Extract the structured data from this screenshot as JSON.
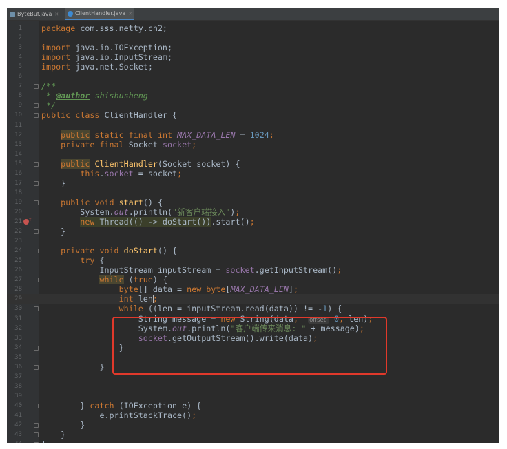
{
  "tabs": [
    {
      "label": "ByteBuf.java",
      "active": false,
      "icon": "java-interface-file-icon"
    },
    {
      "label": "ClientHandler.java",
      "active": true,
      "icon": "java-class-file-icon"
    }
  ],
  "editor": {
    "language": "Java",
    "theme": "Darcula",
    "current_line": 29,
    "breakpoint_line": 21,
    "highlight_box_lines": [
      30,
      34
    ],
    "param_hint": "offset:",
    "lines": [
      {
        "n": "1",
        "tokens": [
          {
            "t": "package",
            "c": "kw"
          },
          {
            "t": " com.sss.netty.ch2;"
          }
        ]
      },
      {
        "n": "2",
        "tokens": []
      },
      {
        "n": "3",
        "tokens": [
          {
            "t": "import",
            "c": "kw"
          },
          {
            "t": " java.io.IOException;"
          }
        ]
      },
      {
        "n": "4",
        "tokens": [
          {
            "t": "import",
            "c": "kw"
          },
          {
            "t": " java.io.InputStream;"
          }
        ]
      },
      {
        "n": "5",
        "tokens": [
          {
            "t": "import",
            "c": "kw"
          },
          {
            "t": " java.net.Socket;"
          }
        ]
      },
      {
        "n": "6",
        "tokens": []
      },
      {
        "n": "7",
        "tokens": [
          {
            "t": "/**",
            "c": "cmt"
          }
        ]
      },
      {
        "n": "8",
        "tokens": [
          {
            "t": " * ",
            "c": "cmt"
          },
          {
            "t": "@author",
            "c": "tag"
          },
          {
            "t": " shishusheng",
            "c": "cmt"
          }
        ]
      },
      {
        "n": "9",
        "tokens": [
          {
            "t": " */",
            "c": "cmt"
          }
        ]
      },
      {
        "n": "10",
        "tokens": [
          {
            "t": "public class",
            "c": "kw"
          },
          {
            "t": " ClientHandler {"
          }
        ]
      },
      {
        "n": "11",
        "tokens": []
      },
      {
        "n": "12",
        "tokens": [
          {
            "t": "    "
          },
          {
            "t": "public",
            "c": "kw hl"
          },
          {
            "t": " static final int",
            "c": "kw"
          },
          {
            "t": " "
          },
          {
            "t": "MAX_DATA_LEN",
            "c": "cst"
          },
          {
            "t": " = "
          },
          {
            "t": "1024",
            "c": "num"
          },
          {
            "t": ";",
            "c": "kw"
          }
        ]
      },
      {
        "n": "13",
        "tokens": [
          {
            "t": "    "
          },
          {
            "t": "private final",
            "c": "kw"
          },
          {
            "t": " Socket "
          },
          {
            "t": "socket",
            "c": "fld"
          },
          {
            "t": ";",
            "c": "kw"
          }
        ]
      },
      {
        "n": "14",
        "tokens": []
      },
      {
        "n": "15",
        "tokens": [
          {
            "t": "    "
          },
          {
            "t": "public",
            "c": "kw hl"
          },
          {
            "t": " "
          },
          {
            "t": "ClientHandler",
            "c": "mth"
          },
          {
            "t": "(Socket socket) {"
          }
        ]
      },
      {
        "n": "16",
        "tokens": [
          {
            "t": "        "
          },
          {
            "t": "this",
            "c": "kw"
          },
          {
            "t": "."
          },
          {
            "t": "socket",
            "c": "fld"
          },
          {
            "t": " = socket"
          },
          {
            "t": ";",
            "c": "kw"
          }
        ]
      },
      {
        "n": "17",
        "tokens": [
          {
            "t": "    }"
          }
        ]
      },
      {
        "n": "18",
        "tokens": []
      },
      {
        "n": "19",
        "tokens": [
          {
            "t": "    "
          },
          {
            "t": "public void",
            "c": "kw"
          },
          {
            "t": " "
          },
          {
            "t": "start",
            "c": "mth"
          },
          {
            "t": "() {"
          }
        ]
      },
      {
        "n": "20",
        "tokens": [
          {
            "t": "        System."
          },
          {
            "t": "out",
            "c": "cst"
          },
          {
            "t": ".println("
          },
          {
            "t": "\"新客户端接入\"",
            "c": "str"
          },
          {
            "t": ")"
          },
          {
            "t": ";",
            "c": "kw"
          }
        ]
      },
      {
        "n": "21",
        "tokens": [
          {
            "t": "        "
          },
          {
            "t": "new",
            "c": "kw hlbox"
          },
          {
            "t": " Thread(() -> doStart())",
            "c": "hlbox"
          },
          {
            "t": ".start()"
          },
          {
            "t": ";",
            "c": "kw"
          }
        ]
      },
      {
        "n": "22",
        "tokens": [
          {
            "t": "    }"
          }
        ]
      },
      {
        "n": "23",
        "tokens": []
      },
      {
        "n": "24",
        "tokens": [
          {
            "t": "    "
          },
          {
            "t": "private void",
            "c": "kw"
          },
          {
            "t": " "
          },
          {
            "t": "doStart",
            "c": "mth"
          },
          {
            "t": "() {"
          }
        ]
      },
      {
        "n": "25",
        "tokens": [
          {
            "t": "        "
          },
          {
            "t": "try",
            "c": "kw"
          },
          {
            "t": " {"
          }
        ]
      },
      {
        "n": "26",
        "tokens": [
          {
            "t": "            InputStream inputStream = "
          },
          {
            "t": "socket",
            "c": "fld"
          },
          {
            "t": ".getInputStream()"
          },
          {
            "t": ";",
            "c": "kw"
          }
        ]
      },
      {
        "n": "27",
        "tokens": [
          {
            "t": "            "
          },
          {
            "t": "while",
            "c": "kw hl"
          },
          {
            "t": " ("
          },
          {
            "t": "true",
            "c": "kw"
          },
          {
            "t": ") {"
          }
        ]
      },
      {
        "n": "28",
        "tokens": [
          {
            "t": "                "
          },
          {
            "t": "byte",
            "c": "kw"
          },
          {
            "t": "[] data = "
          },
          {
            "t": "new byte",
            "c": "kw"
          },
          {
            "t": "["
          },
          {
            "t": "MAX_DATA_LEN",
            "c": "cst"
          },
          {
            "t": "]"
          },
          {
            "t": ";",
            "c": "kw"
          }
        ]
      },
      {
        "n": "29",
        "tokens": [
          {
            "t": "                "
          },
          {
            "t": "int",
            "c": "kw"
          },
          {
            "t": " len"
          },
          {
            "t": ";",
            "c": "kw"
          }
        ]
      },
      {
        "n": "30",
        "tokens": [
          {
            "t": "                "
          },
          {
            "t": "while",
            "c": "kw"
          },
          {
            "t": " ((len = inputStream.read(data)) != -"
          },
          {
            "t": "1",
            "c": "num"
          },
          {
            "t": ") {"
          }
        ]
      },
      {
        "n": "31",
        "tokens": [
          {
            "t": "                    String message = "
          },
          {
            "t": "new",
            "c": "kw"
          },
          {
            "t": " String(data"
          },
          {
            "t": ",",
            "c": "kw"
          },
          {
            "t": "  "
          },
          {
            "t": "offset:",
            "c": "hint",
            "bind": "editor.param_hint"
          },
          {
            "t": " "
          },
          {
            "t": "0",
            "c": "num"
          },
          {
            "t": ",",
            "c": "kw"
          },
          {
            "t": " len)"
          },
          {
            "t": ";",
            "c": "kw"
          }
        ]
      },
      {
        "n": "32",
        "tokens": [
          {
            "t": "                    System."
          },
          {
            "t": "out",
            "c": "cst"
          },
          {
            "t": ".println("
          },
          {
            "t": "\"客户端传来消息: \"",
            "c": "str"
          },
          {
            "t": " + message)"
          },
          {
            "t": ";",
            "c": "kw"
          }
        ]
      },
      {
        "n": "33",
        "tokens": [
          {
            "t": "                    "
          },
          {
            "t": "socket",
            "c": "fld"
          },
          {
            "t": ".getOutputStream().write(data)"
          },
          {
            "t": ";",
            "c": "kw"
          }
        ]
      },
      {
        "n": "34",
        "tokens": [
          {
            "t": "                }"
          }
        ]
      },
      {
        "n": "35",
        "tokens": []
      },
      {
        "n": "36",
        "tokens": [
          {
            "t": "            }"
          }
        ]
      },
      {
        "n": "37",
        "tokens": []
      },
      {
        "n": "38",
        "tokens": []
      },
      {
        "n": "39",
        "tokens": []
      },
      {
        "n": "40",
        "tokens": [
          {
            "t": "        } "
          },
          {
            "t": "catch",
            "c": "kw"
          },
          {
            "t": " (IOException e) {"
          }
        ]
      },
      {
        "n": "41",
        "tokens": [
          {
            "t": "            e.printStackTrace()"
          },
          {
            "t": ";",
            "c": "kw"
          }
        ]
      },
      {
        "n": "42",
        "tokens": [
          {
            "t": "        }"
          }
        ]
      },
      {
        "n": "43",
        "tokens": [
          {
            "t": "    }"
          }
        ]
      },
      {
        "n": "44",
        "tokens": [
          {
            "t": "}"
          }
        ]
      }
    ]
  },
  "colors": {
    "background": "#2b2b2b",
    "gutter": "#313335",
    "keyword": "#cc7832",
    "string": "#6a8759",
    "method": "#ffc66d",
    "field": "#9876aa",
    "number": "#6897bb",
    "annotation_box": "#e0392b"
  }
}
